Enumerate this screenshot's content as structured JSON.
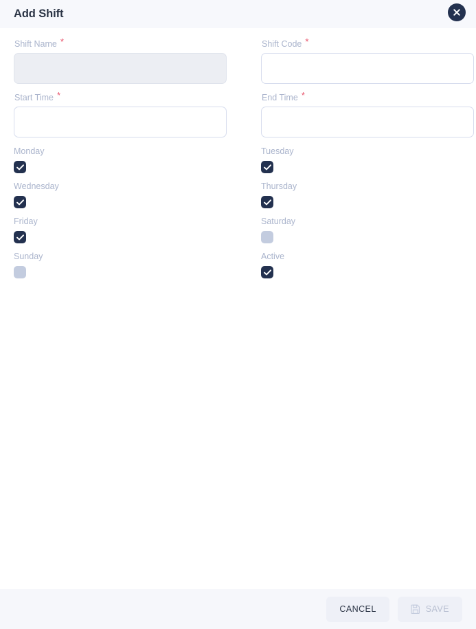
{
  "dialog": {
    "title": "Add Shift",
    "close_label": "Close",
    "close_icon": "close-icon"
  },
  "form": {
    "fields": [
      {
        "label": "Shift Name",
        "required": true,
        "value": "",
        "placeholder": "",
        "variant": "filled"
      },
      {
        "label": "Shift Code",
        "required": true,
        "value": "",
        "placeholder": "",
        "variant": "plain"
      },
      {
        "label": "Start Time",
        "required": true,
        "value": "",
        "placeholder": "",
        "variant": "plain"
      },
      {
        "label": "End Time",
        "required": true,
        "value": "",
        "placeholder": "",
        "variant": "plain"
      }
    ],
    "required_marker": "*",
    "checkboxes": [
      {
        "label": "Monday",
        "checked": true
      },
      {
        "label": "Tuesday",
        "checked": true
      },
      {
        "label": "Wednesday",
        "checked": true
      },
      {
        "label": "Thursday",
        "checked": true
      },
      {
        "label": "Friday",
        "checked": true
      },
      {
        "label": "Saturday",
        "checked": false
      },
      {
        "label": "Sunday",
        "checked": false
      },
      {
        "label": "Active",
        "checked": true
      }
    ]
  },
  "footer": {
    "cancel_label": "CANCEL",
    "save_label": "SAVE",
    "save_icon": "save-disk-icon",
    "save_disabled": true
  },
  "colors": {
    "header_bg": "#f7f8fc",
    "footer_bg": "#f6f7fb",
    "body_bg": "#ffffff",
    "title_text": "#2b3445",
    "label_text": "#aab4cc",
    "required_star": "#e8536b",
    "checkbox_checked": "#23314f",
    "checkbox_unchecked": "#c3ccdf",
    "input_border": "#d6dced",
    "input_filled_bg": "#eceef3",
    "button_bg": "#eef0f7",
    "save_disabled_text": "#b9c0d2"
  }
}
